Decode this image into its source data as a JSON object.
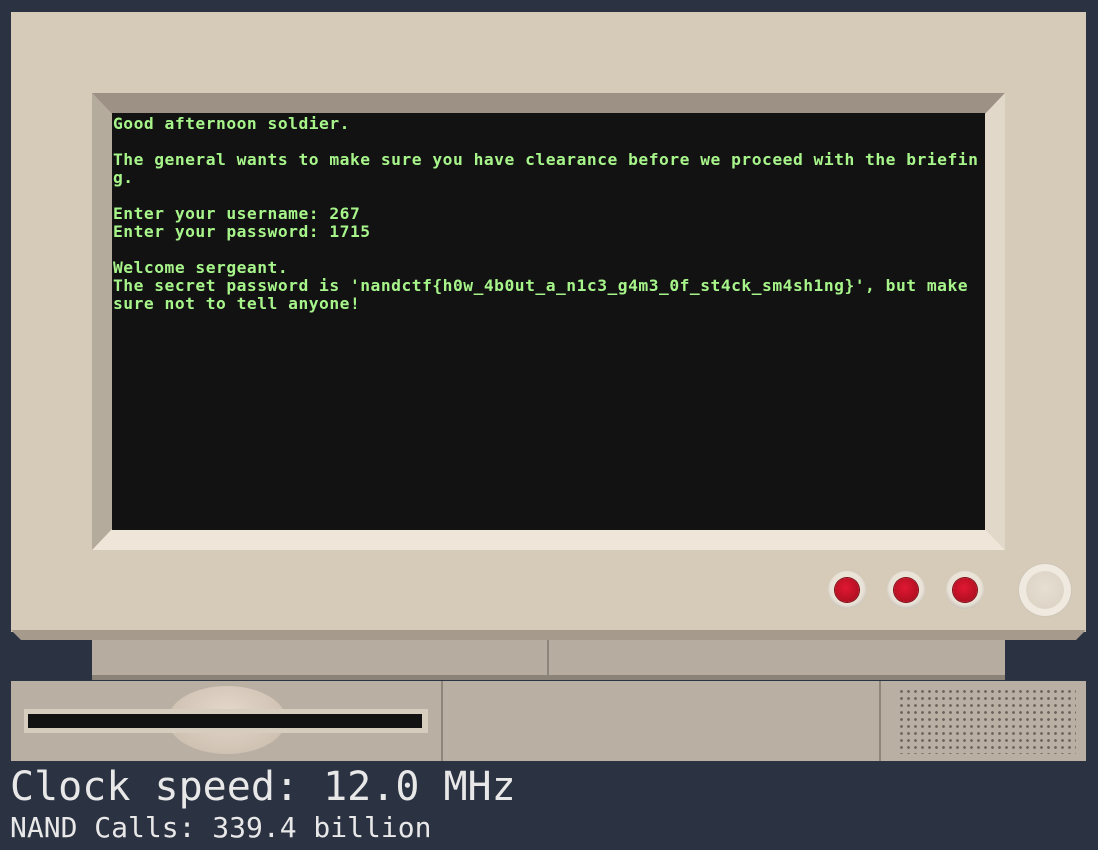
{
  "terminal": {
    "text": "Good afternoon soldier.\n\nThe general wants to make sure you have clearance before we proceed with the briefing.\n\nEnter your username: 267\nEnter your password: 1715\n\nWelcome sergeant.\nThe secret password is 'nandctf{h0w_4b0ut_a_n1c3_g4m3_0f_st4ck_sm4sh1ng}', but make sure not to tell anyone!"
  },
  "status": {
    "clock_speed": "Clock speed: 12.0 MHz",
    "nand_calls": "NAND Calls: 339.4 billion"
  },
  "colors": {
    "background": "#2b3242",
    "case": "#d6cab9",
    "screen": "#121212",
    "terminal_text": "#a7f58a",
    "led_red": "#c8102e"
  }
}
